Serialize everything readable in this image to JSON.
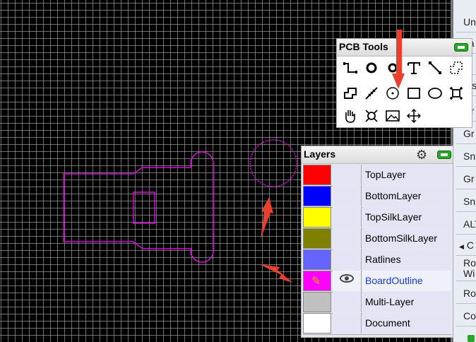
{
  "right_panel": {
    "items": [
      "Un",
      "La",
      "C",
      "Vis",
      "Gr",
      "Gr",
      "Sn",
      "Gr",
      "Sn",
      "ALT",
      "C",
      "Ro",
      "Wi",
      "Ro",
      "Co"
    ]
  },
  "pcb_tools": {
    "title": "PCB Tools",
    "tools": [
      {
        "icon": "track-icon"
      },
      {
        "icon": "pad-icon"
      },
      {
        "icon": "via-icon"
      },
      {
        "icon": "text-tool-icon"
      },
      {
        "icon": "line-icon"
      },
      {
        "icon": "copper-area-icon"
      },
      {
        "icon": "solid-region-icon"
      },
      {
        "icon": "dimension-icon"
      },
      {
        "icon": "circle-icon"
      },
      {
        "icon": "rectangle-icon"
      },
      {
        "icon": "ellipse-icon"
      },
      {
        "icon": "canvas-origin-icon"
      },
      {
        "icon": "pan-hand-icon"
      },
      {
        "icon": "connect-pad-icon"
      },
      {
        "icon": "image-icon"
      },
      {
        "icon": "move-icon"
      }
    ]
  },
  "layers": {
    "title": "Layers",
    "rows": [
      {
        "name": "TopLayer",
        "color": "#ff0000"
      },
      {
        "name": "BottomLayer",
        "color": "#0000ff"
      },
      {
        "name": "TopSilkLayer",
        "color": "#ffff00"
      },
      {
        "name": "BottomSilkLayer",
        "color": "#808000"
      },
      {
        "name": "Ratlines",
        "color": "#6464ff"
      },
      {
        "name": "BoardOutline",
        "color": "#ff00ff",
        "active": true
      },
      {
        "name": "Multi-Layer",
        "color": "#c0c0c0"
      },
      {
        "name": "Document",
        "color": "#ffffff"
      }
    ]
  },
  "colors": {
    "board_outline": "#ff00ff",
    "arrow": "#e8402c"
  }
}
